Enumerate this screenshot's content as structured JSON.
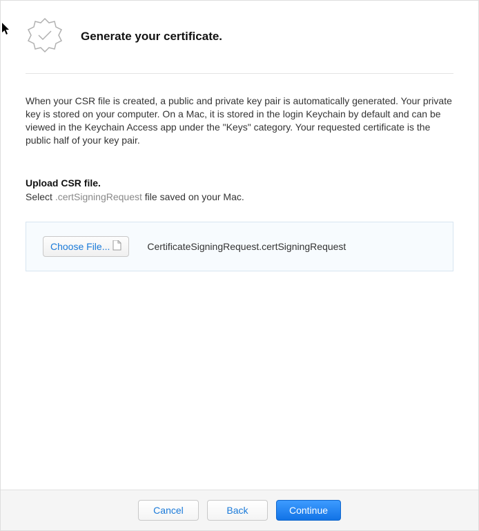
{
  "header": {
    "title": "Generate your certificate."
  },
  "description": "When your CSR file is created, a public and private key pair is automatically generated. Your private key is stored on your computer. On a Mac, it is stored in the login Keychain by default and can be viewed in the Keychain Access app under the \"Keys\" category. Your requested certificate is the public half of your key pair.",
  "upload": {
    "title": "Upload CSR file.",
    "help_prefix": "Select ",
    "help_ext": ".certSigningRequest",
    "help_suffix": " file saved on your Mac.",
    "choose_file_label": "Choose File...",
    "selected_filename": "CertificateSigningRequest.certSigningRequest"
  },
  "footer": {
    "cancel": "Cancel",
    "back": "Back",
    "continue": "Continue"
  }
}
